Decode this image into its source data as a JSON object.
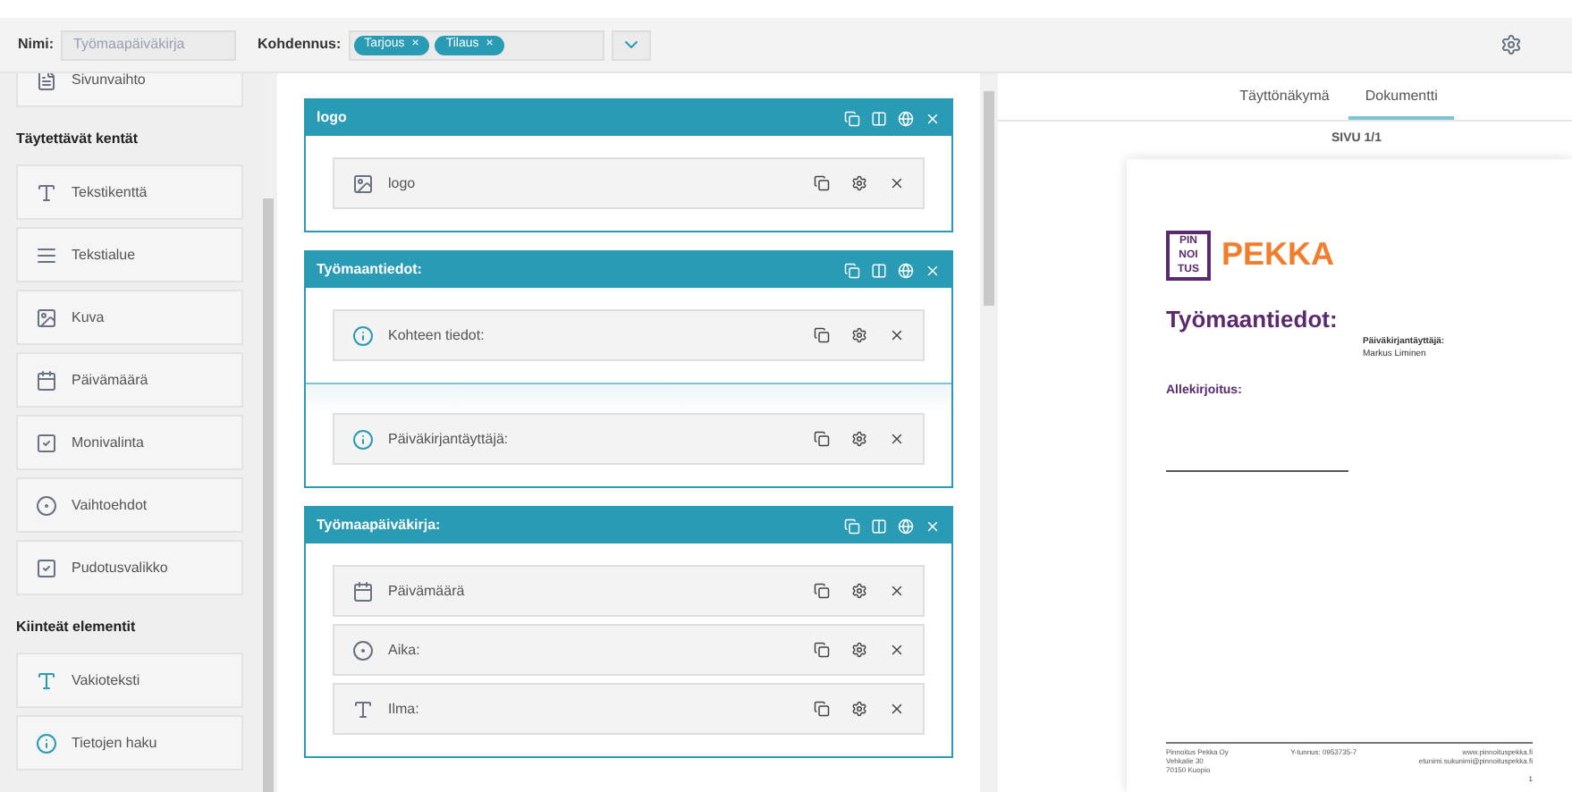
{
  "toolbar": {
    "name_label": "Nimi:",
    "name_value": "Työmaapäiväkirja",
    "target_label": "Kohdennus:",
    "tags": [
      "Tarjous",
      "Tilaus"
    ],
    "tag_remove": "×"
  },
  "sidebar": [
    {
      "kind": "page",
      "label": "Sivunvaihto"
    },
    {
      "kind": "heading",
      "label": "Täytettävät kentät"
    },
    {
      "kind": "text",
      "label": "Tekstikenttä"
    },
    {
      "kind": "lines",
      "label": "Tekstialue"
    },
    {
      "kind": "image",
      "label": "Kuva"
    },
    {
      "kind": "calendar",
      "label": "Päivämäärä"
    },
    {
      "kind": "check",
      "label": "Monivalinta"
    },
    {
      "kind": "radio",
      "label": "Vaihtoehdot"
    },
    {
      "kind": "check",
      "label": "Pudotusvalikko"
    },
    {
      "kind": "heading",
      "label": "Kiinteät elementit"
    },
    {
      "kind": "statictext",
      "label": "Vakioteksti"
    },
    {
      "kind": "info",
      "label": "Tietojen haku"
    }
  ],
  "sections": [
    {
      "title": "logo",
      "groups": [
        [
          {
            "kind": "image",
            "label": "logo"
          }
        ]
      ]
    },
    {
      "title": "Työmaantiedot:",
      "groups": [
        [
          {
            "kind": "info",
            "label": "Kohteen tiedot:"
          }
        ],
        [
          {
            "kind": "info",
            "label": "Päiväkirjantäyttäjä:"
          }
        ]
      ]
    },
    {
      "title": "Työmaapäiväkirja:",
      "groups": [
        [
          {
            "kind": "calendar",
            "label": "Päivämäärä"
          },
          {
            "kind": "radio",
            "label": "Aika:"
          },
          {
            "kind": "text",
            "label": "Ilma:"
          }
        ]
      ]
    }
  ],
  "preview": {
    "tabs": [
      {
        "label": "Täyttönäkymä",
        "selected": false
      },
      {
        "label": "Dokumentti",
        "selected": true
      }
    ],
    "page_label": "SIVU 1/1",
    "document": {
      "logo_letters": [
        "PIN",
        "NOI",
        "TUS"
      ],
      "logo_word": "PEKKA",
      "heading": "Työmaantiedot:",
      "field_label": "Päiväkirjantäyttäjä:",
      "field_value": "Markus Liminen",
      "signature_label": "Allekirjoitus:",
      "footer": [
        [
          "Pinnoitus Pekka Oy",
          "Vehkatie 30",
          "70150 Kuopio"
        ],
        [
          "Y-tunnus: 0953735-7"
        ],
        [
          "www.pinnoituspekka.fi",
          "etunimi.sukunimi@pinnoituspekka.fi"
        ]
      ],
      "page_number": "1"
    }
  }
}
